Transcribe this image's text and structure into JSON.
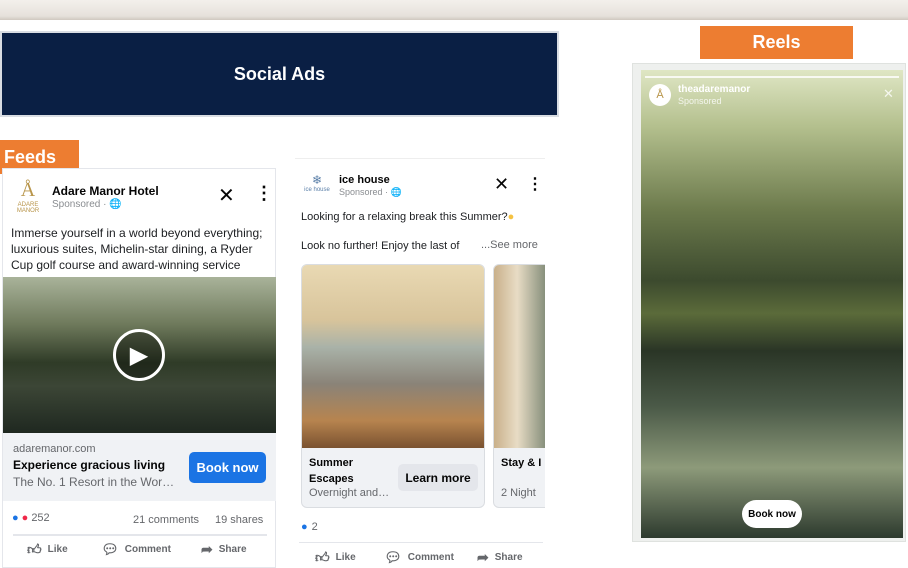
{
  "banner": {
    "title": "Social Ads"
  },
  "labels": {
    "feeds": "Feeds",
    "reels": "Reels"
  },
  "colors": {
    "navy": "#0a1f44",
    "orange": "#ed7d31",
    "fb_blue": "#1b74e4"
  },
  "ad1": {
    "advertiser": "Adare Manor Hotel",
    "sponsored": "Sponsored · ",
    "logo_text": "ADARE MANOR",
    "body": "Immerse yourself in a world beyond everything; luxurious suites, Michelin-star dining, a Ryder Cup golf course and award-winning service",
    "domain": "adaremanor.com",
    "headline": "Experience gracious living",
    "description": "The No. 1 Resort in the Wor…",
    "cta": "Book now",
    "reactions": "252",
    "comments": "21 comments",
    "shares": "19 shares",
    "like": "Like",
    "comment": "Comment",
    "share": "Share"
  },
  "ad2": {
    "advertiser": "ice house",
    "logo_text": "ice house",
    "sponsored": "Sponsored · ",
    "body1": "Looking for a relaxing break this Summer?",
    "body2": "Look no further! Enjoy the last of",
    "see_more": "...See more",
    "cards": [
      {
        "title": "Summer Escapes",
        "desc": "Overnight and…",
        "cta": "Learn more"
      },
      {
        "title": "Stay & I",
        "desc": "2 Night"
      }
    ],
    "reactions": "2",
    "like": "Like",
    "comment": "Comment",
    "share": "Share"
  },
  "reel": {
    "account": "theadaremanor",
    "sponsored": "Sponsored",
    "cta": "Book now"
  }
}
